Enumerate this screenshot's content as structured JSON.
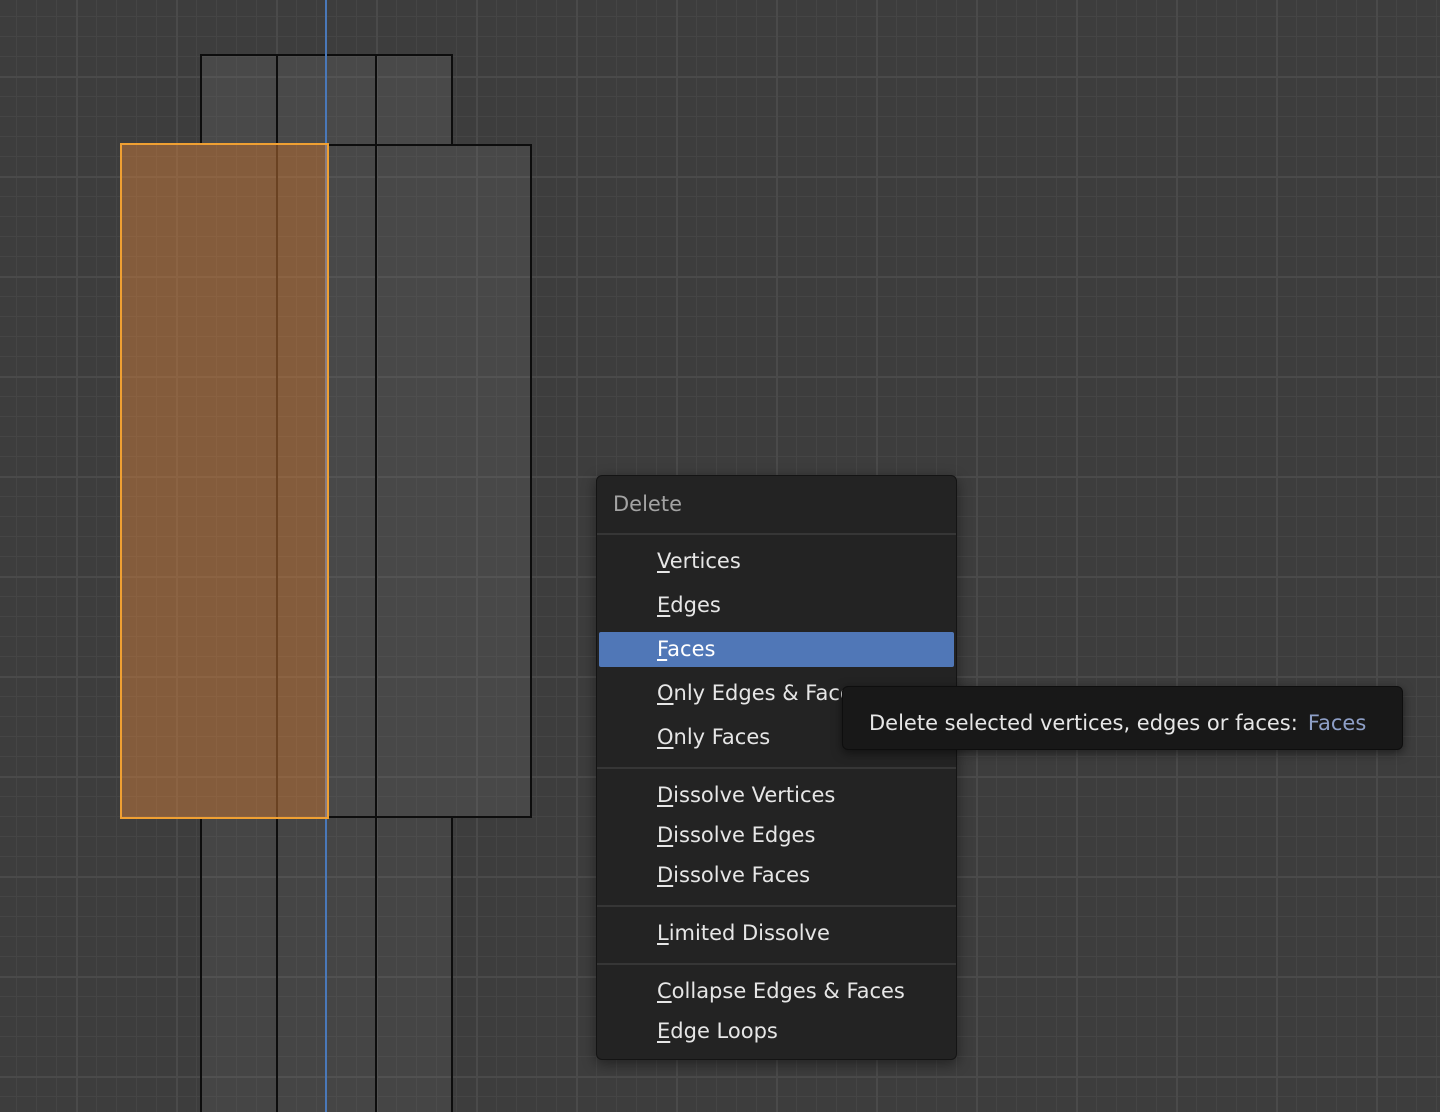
{
  "menu": {
    "title": "Delete",
    "items": [
      {
        "label": "Vertices"
      },
      {
        "label": "Edges"
      },
      {
        "label": "Faces"
      },
      {
        "label": "Only Edges & Faces"
      },
      {
        "label": "Only Faces"
      },
      {
        "label": "Dissolve Vertices"
      },
      {
        "label": "Dissolve Edges"
      },
      {
        "label": "Dissolve Faces"
      },
      {
        "label": "Limited Dissolve"
      },
      {
        "label": "Collapse Edges & Faces"
      },
      {
        "label": "Edge Loops"
      }
    ],
    "highlighted_item": "Faces"
  },
  "tooltip": {
    "text": "Delete selected vertices, edges or faces:",
    "value": "Faces"
  },
  "colors": {
    "selection_orange": "#f0a032",
    "highlight_blue": "#5077b7",
    "axis_blue": "#4a78b8"
  }
}
